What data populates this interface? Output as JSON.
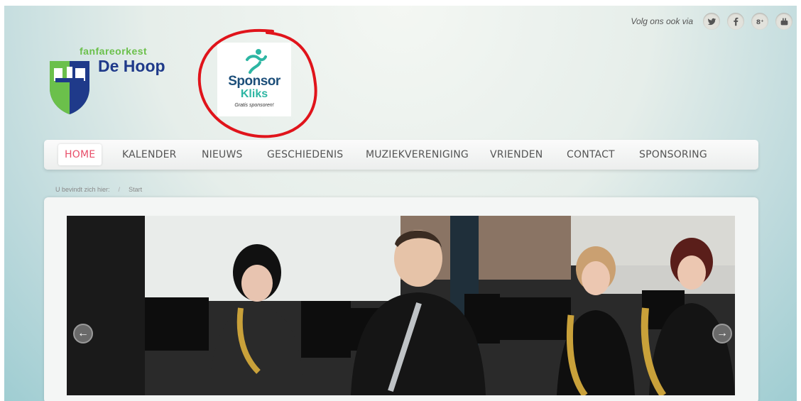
{
  "header": {
    "follow_label": "Volg ons ook via",
    "social": [
      {
        "icon": "twitter-icon",
        "glyph": "t"
      },
      {
        "icon": "facebook-icon",
        "glyph": "f"
      },
      {
        "icon": "google-plus-icon",
        "glyph": "g+"
      },
      {
        "icon": "youtube-icon",
        "glyph": "yt"
      }
    ]
  },
  "logo": {
    "kicker": "fanfareorkest",
    "title": "De Hoop"
  },
  "sponsor": {
    "line1": "Sponsor",
    "line2": "Kliks",
    "tagline": "Gratis sponsoren!"
  },
  "nav": {
    "items": [
      {
        "label": "HOME",
        "active": true
      },
      {
        "label": "KALENDER"
      },
      {
        "label": "NIEUWS"
      },
      {
        "label": "GESCHIEDENIS"
      },
      {
        "label": "MUZIEKVERENIGING"
      },
      {
        "label": "VRIENDEN"
      },
      {
        "label": "CONTACT"
      },
      {
        "label": "SPONSORING"
      }
    ]
  },
  "breadcrumb": {
    "prefix": "U bevindt zich hier:",
    "current": "Start"
  },
  "slider": {
    "prev_glyph": "←",
    "next_glyph": "→"
  },
  "colors": {
    "accent": "#e84f6a",
    "annotation": "#e0141b",
    "logo_blue": "#1f3a8a",
    "logo_green": "#6bc04b"
  }
}
